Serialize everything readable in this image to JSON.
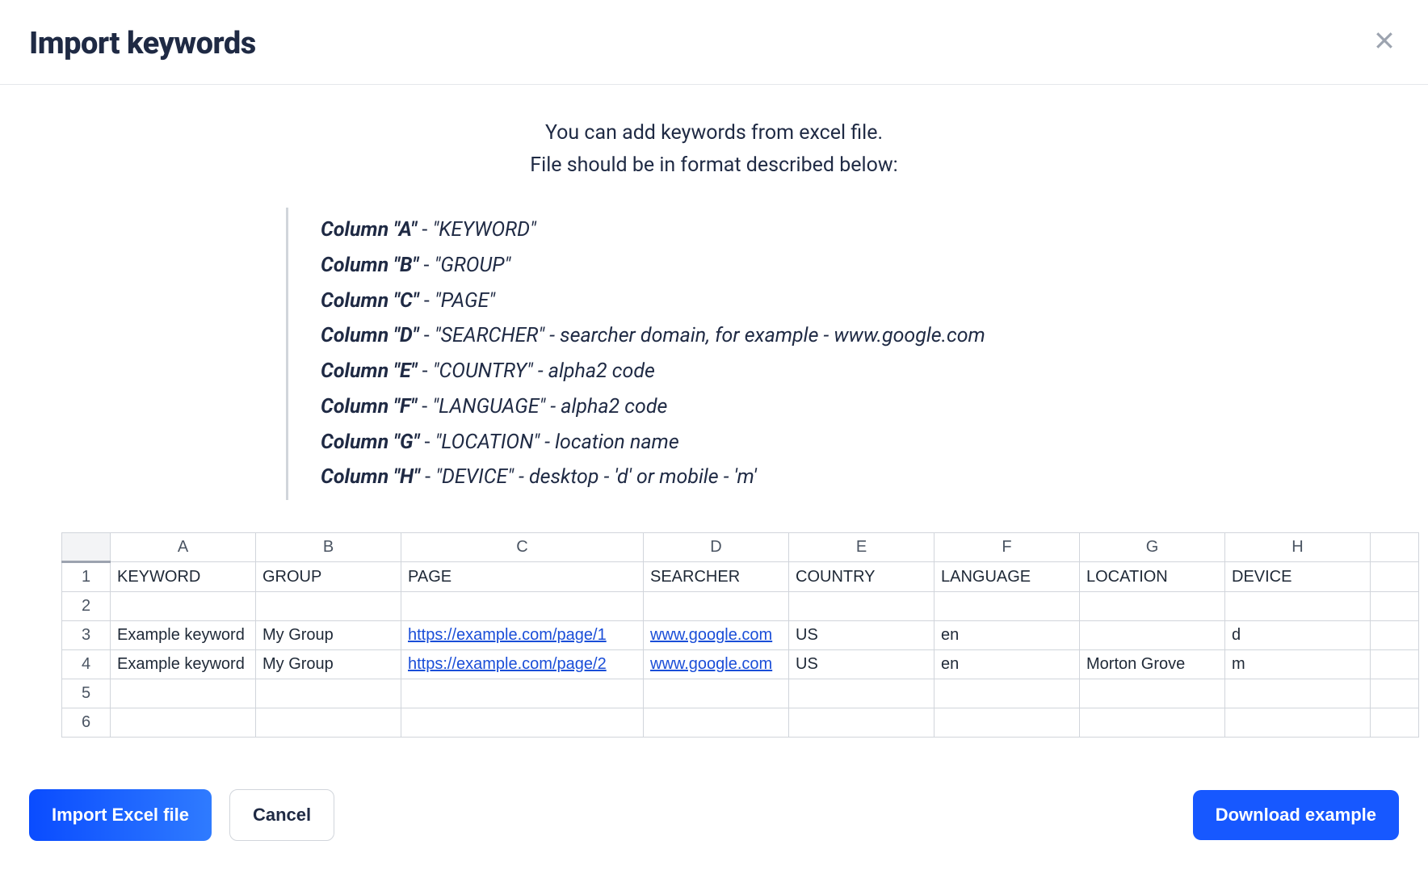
{
  "title": "Import keywords",
  "intro": {
    "line1": "You can add keywords from excel file.",
    "line2": "File should be in format described below:"
  },
  "columns": [
    {
      "name": "Column \"A\"",
      "label": "\"KEYWORD\"",
      "note": ""
    },
    {
      "name": "Column \"B\"",
      "label": "\"GROUP\"",
      "note": ""
    },
    {
      "name": "Column \"C\"",
      "label": "\"PAGE\"",
      "note": ""
    },
    {
      "name": "Column \"D\"",
      "label": "\"SEARCHER\"",
      "note": " - searcher domain, for example - www.google.com"
    },
    {
      "name": "Column \"E\"",
      "label": "\"COUNTRY\"",
      "note": " - alpha2 code"
    },
    {
      "name": "Column \"F\"",
      "label": "\"LANGUAGE\"",
      "note": " - alpha2 code"
    },
    {
      "name": "Column \"G\"",
      "label": "\"LOCATION\"",
      "note": " - location name"
    },
    {
      "name": "Column \"H\"",
      "label": "\"DEVICE\"",
      "note": " - desktop - 'd' or mobile - 'm'"
    }
  ],
  "sheet": {
    "col_headers": [
      "A",
      "B",
      "C",
      "D",
      "E",
      "F",
      "G",
      "H"
    ],
    "row_nums": [
      "1",
      "2",
      "3",
      "4",
      "5",
      "6"
    ],
    "header_row": [
      "KEYWORD",
      "GROUP",
      "PAGE",
      "SEARCHER",
      "COUNTRY",
      "LANGUAGE",
      "LOCATION",
      "DEVICE"
    ],
    "rows": [
      [
        "",
        "",
        "",
        "",
        "",
        "",
        "",
        ""
      ],
      [
        "Example keyword",
        "My Group",
        "https://example.com/page/1",
        "www.google.com",
        "US",
        "en",
        "",
        "d"
      ],
      [
        "Example keyword",
        "My Group",
        "https://example.com/page/2",
        "www.google.com",
        "US",
        "en",
        "Morton Grove",
        "m"
      ],
      [
        "",
        "",
        "",
        "",
        "",
        "",
        "",
        ""
      ],
      [
        "",
        "",
        "",
        "",
        "",
        "",
        "",
        ""
      ]
    ],
    "link_cols": [
      2,
      3
    ]
  },
  "buttons": {
    "import": "Import Excel file",
    "cancel": "Cancel",
    "download": "Download example"
  }
}
